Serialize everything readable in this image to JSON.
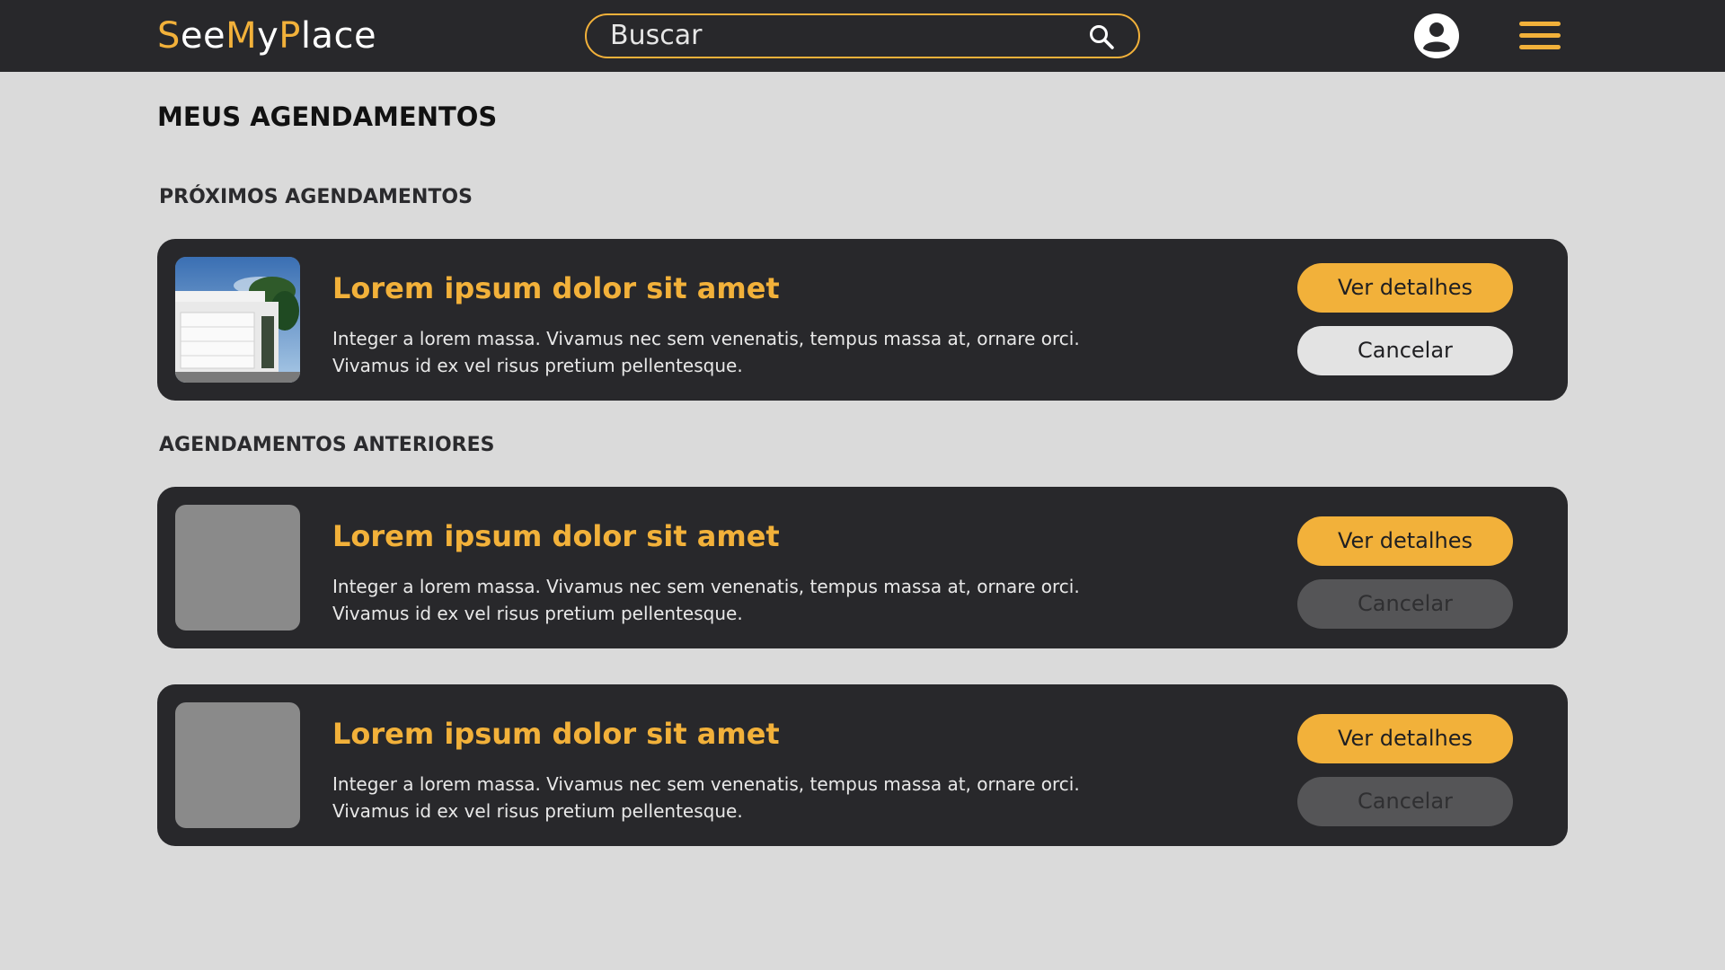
{
  "header": {
    "logo": [
      {
        "text": "S",
        "accent": true
      },
      {
        "text": "ee",
        "accent": false
      },
      {
        "text": "M",
        "accent": true
      },
      {
        "text": "y",
        "accent": false
      },
      {
        "text": "P",
        "accent": true
      },
      {
        "text": "lace",
        "accent": false
      }
    ],
    "search_placeholder": "Buscar",
    "icons": {
      "search": "search-icon",
      "profile": "user-circle-icon",
      "menu": "hamburger-menu-icon"
    }
  },
  "colors": {
    "accent": "#f2b13a",
    "card_bg": "#28282b",
    "page_bg": "#dadada"
  },
  "page_title": "MEUS AGENDAMENTOS",
  "sections": {
    "upcoming": {
      "title": "PRÓXIMOS AGENDAMENTOS",
      "items": [
        {
          "title": "Lorem ipsum dolor sit amet",
          "description_line1": "Integer a lorem massa. Vivamus nec sem venenatis, tempus massa at, ornare orci.",
          "description_line2": "Vivamus id ex vel risus pretium pellentesque.",
          "details_label": "Ver detalhes",
          "cancel_label": "Cancelar",
          "cancel_enabled": true,
          "image": "house-photo"
        }
      ]
    },
    "past": {
      "title": "AGENDAMENTOS ANTERIORES",
      "items": [
        {
          "title": "Lorem ipsum dolor sit amet",
          "description_line1": "Integer a lorem massa. Vivamus nec sem venenatis, tempus massa at, ornare orci.",
          "description_line2": "Vivamus id ex vel risus pretium pellentesque.",
          "details_label": "Ver detalhes",
          "cancel_label": "Cancelar",
          "cancel_enabled": false,
          "image": "placeholder"
        },
        {
          "title": "Lorem ipsum dolor sit amet",
          "description_line1": "Integer a lorem massa. Vivamus nec sem venenatis, tempus massa at, ornare orci.",
          "description_line2": "Vivamus id ex vel risus pretium pellentesque.",
          "details_label": "Ver detalhes",
          "cancel_label": "Cancelar",
          "cancel_enabled": false,
          "image": "placeholder"
        }
      ]
    }
  }
}
